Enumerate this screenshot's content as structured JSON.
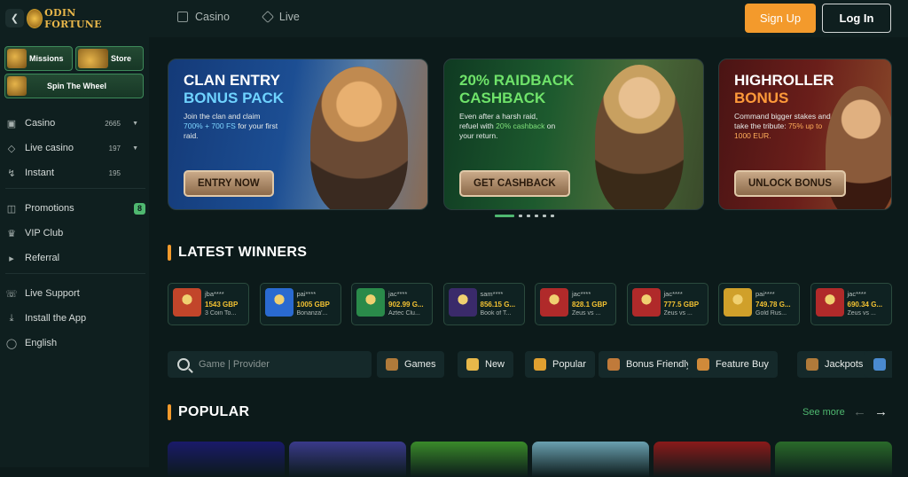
{
  "brand": {
    "name": "ODIN FORTUNE"
  },
  "topnav": {
    "items": [
      {
        "label": "Casino",
        "icon": "dice-icon"
      },
      {
        "label": "Live",
        "icon": "diamond-icon"
      }
    ]
  },
  "auth": {
    "signup": "Sign Up",
    "login": "Log In"
  },
  "sidebar": {
    "promos": [
      {
        "label": "Missions"
      },
      {
        "label": "Store"
      },
      {
        "label": "Spin The Wheel"
      }
    ],
    "items": [
      {
        "label": "Casino",
        "count": "2665",
        "icon": "casino-icon"
      },
      {
        "label": "Live casino",
        "count": "197",
        "icon": "live-icon"
      },
      {
        "label": "Instant",
        "count": "195",
        "icon": "lightning-icon"
      },
      {
        "label": "Promotions",
        "badge": "8",
        "icon": "gift-icon"
      },
      {
        "label": "VIP Club",
        "icon": "crown-icon"
      },
      {
        "label": "Referral",
        "icon": "megaphone-icon"
      },
      {
        "label": "Live Support",
        "icon": "headset-icon"
      },
      {
        "label": "Install the App",
        "icon": "download-icon"
      },
      {
        "label": "English",
        "icon": "globe-icon"
      }
    ]
  },
  "banners": [
    {
      "title1": "CLAN ENTRY",
      "title2": "BONUS PACK",
      "title2_color": "#6fd3ff",
      "text1": "Join the clan and claim ",
      "highlight": "700% + 700 FS",
      "text2": " for your first raid.",
      "button": "ENTRY NOW"
    },
    {
      "title1": "20% RAIDBACK",
      "title2": "CASHBACK",
      "title1_color": "#6fe36a",
      "title2_color": "#6fe36a",
      "text1": "Even after a harsh raid, refuel with ",
      "highlight": "20% cashback",
      "text2": " on your return.",
      "button": "GET CASHBACK"
    },
    {
      "title1": "HIGHROLLER",
      "title2": "BONUS",
      "title2_color": "#ff9a3a",
      "text1": "Command bigger stakes and take the tribute: ",
      "highlight": "75% up to 1000 EUR.",
      "text2": "",
      "button": "UNLOCK BONUS"
    }
  ],
  "latest_winners": {
    "title": "LATEST WINNERS",
    "items": [
      {
        "user": "jba****",
        "amount": "1543 GBP",
        "game": "3 Coin To...",
        "color": "#c2452a"
      },
      {
        "user": "pai****",
        "amount": "1005 GBP",
        "game": "Bonanza'...",
        "color": "#2a6ad0"
      },
      {
        "user": "jac****",
        "amount": "902.99 G...",
        "game": "Aztec Clu...",
        "color": "#2a8a4a"
      },
      {
        "user": "sam****",
        "amount": "856.15 G...",
        "game": "Book of T...",
        "color": "#3a2a6a"
      },
      {
        "user": "jac****",
        "amount": "828.1 GBP",
        "game": "Zeus vs ...",
        "color": "#b02a2a"
      },
      {
        "user": "jac****",
        "amount": "777.5 GBP",
        "game": "Zeus vs ...",
        "color": "#b02a2a"
      },
      {
        "user": "pai****",
        "amount": "749.78 G...",
        "game": "Gold Rus...",
        "color": "#d0a02a"
      },
      {
        "user": "jac****",
        "amount": "690.34 G...",
        "game": "Zeus vs ...",
        "color": "#b02a2a"
      }
    ]
  },
  "search": {
    "placeholder": "Game | Provider"
  },
  "filters": [
    {
      "label": "Games",
      "icon": "chest-icon",
      "color": "#b07a3a"
    },
    {
      "label": "New",
      "icon": "star-icon",
      "color": "#e8b84a"
    },
    {
      "label": "Popular",
      "icon": "trophy-icon",
      "color": "#e0a030"
    },
    {
      "label": "Bonus Friendly",
      "icon": "helmet-icon",
      "color": "#c07a3a"
    },
    {
      "label": "Feature Buy",
      "icon": "treasure-icon",
      "color": "#d08a3a"
    },
    {
      "label": "Jackpots",
      "icon": "pot-icon",
      "color": "#b07a3a"
    },
    {
      "label": "",
      "icon": "diamond-gem-icon",
      "color": "#4a8ad0"
    }
  ],
  "popular": {
    "title": "POPULAR",
    "see_more": "See more"
  },
  "tile_colors": [
    "#1a1a6a",
    "#3a3a8a",
    "#3a8a2a",
    "#6aa0b0",
    "#8a1a1a",
    "#2a6a2a"
  ]
}
